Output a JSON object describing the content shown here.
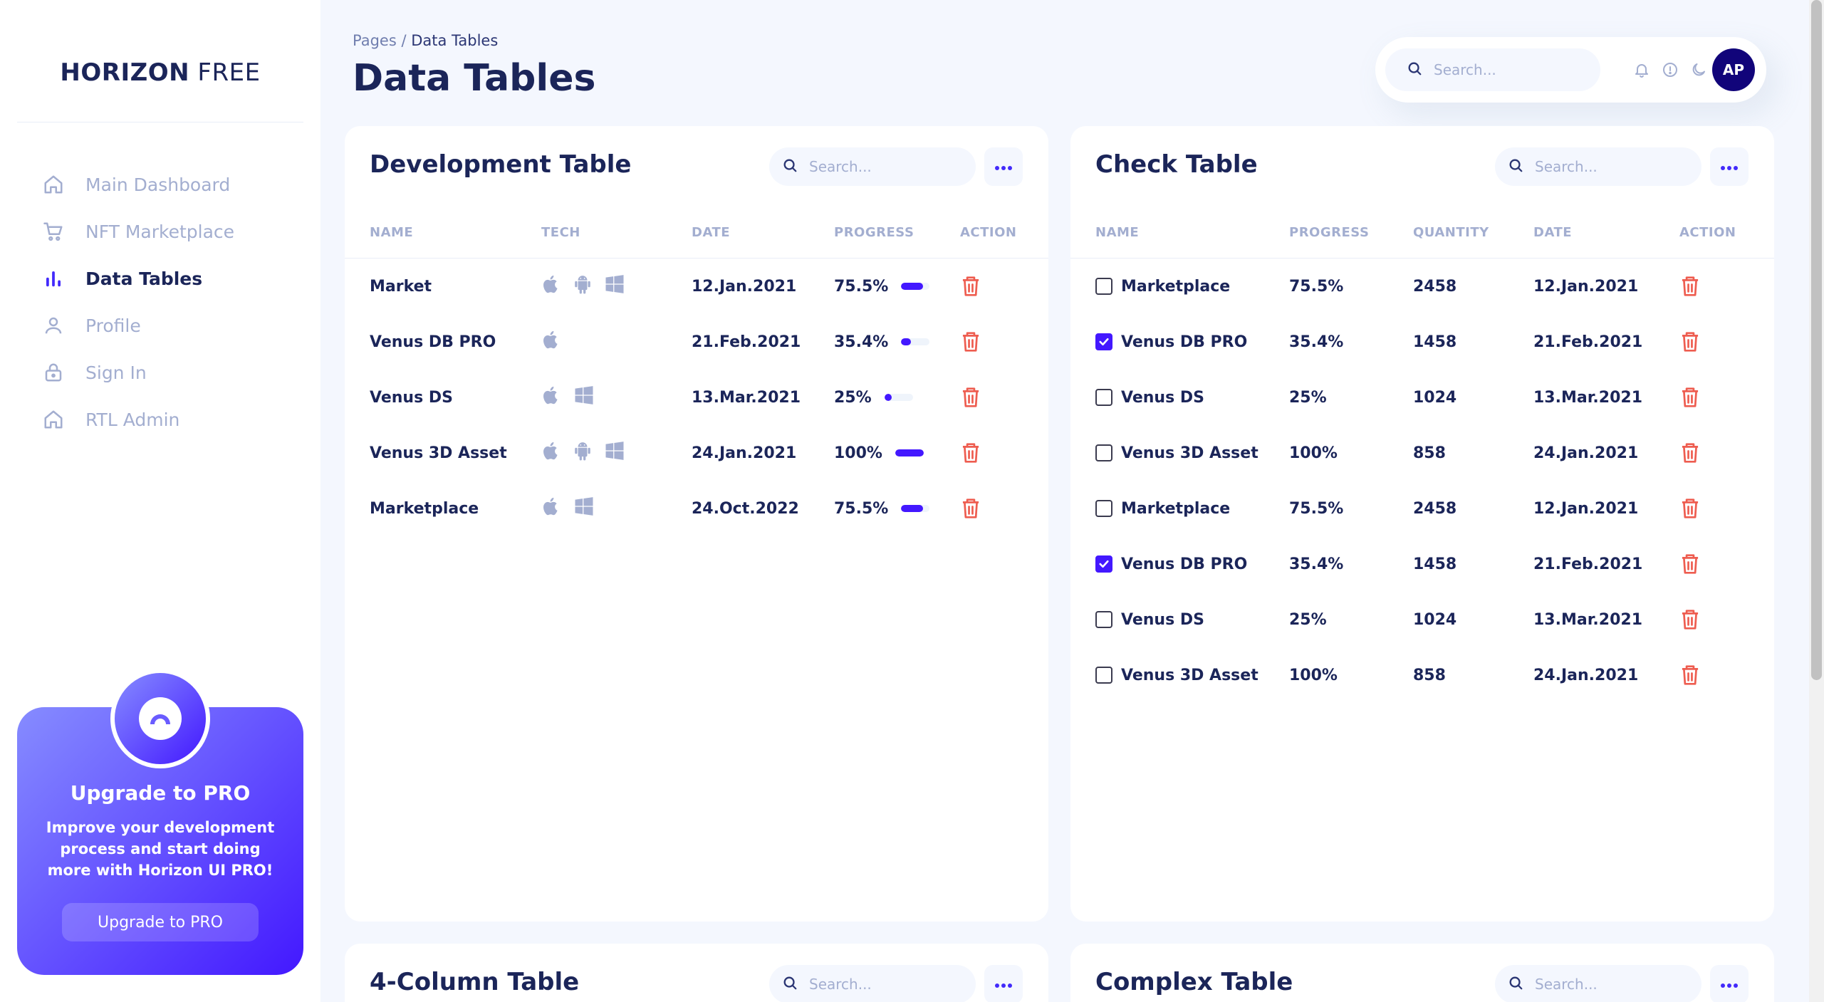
{
  "sidebar": {
    "brand_bold": "HORIZON",
    "brand_light": "FREE",
    "items": [
      {
        "label": "Main Dashboard",
        "icon": "home-icon"
      },
      {
        "label": "NFT Marketplace",
        "icon": "cart-icon"
      },
      {
        "label": "Data Tables",
        "icon": "bar-chart-icon",
        "active": true
      },
      {
        "label": "Profile",
        "icon": "user-icon"
      },
      {
        "label": "Sign In",
        "icon": "lock-icon"
      },
      {
        "label": "RTL Admin",
        "icon": "home-icon"
      }
    ],
    "upgrade": {
      "title": "Upgrade to PRO",
      "text": "Improve your development process and start doing more with Horizon UI PRO!",
      "button": "Upgrade to PRO"
    }
  },
  "header": {
    "breadcrumb_parent": "Pages",
    "breadcrumb_sep": " / ",
    "breadcrumb_current": "Data Tables",
    "title": "Data Tables",
    "search_placeholder": "Search...",
    "avatar_initials": "AP"
  },
  "colors": {
    "accent": "#4318ff",
    "navy": "#1b2559",
    "muted": "#a3aed0",
    "danger": "#ee5d50",
    "background": "#f4f7fe"
  },
  "development_table": {
    "title": "Development Table",
    "search_placeholder": "Search...",
    "columns": [
      "NAME",
      "TECH",
      "DATE",
      "PROGRESS",
      "ACTION"
    ],
    "rows": [
      {
        "name": "Market",
        "tech": [
          "apple",
          "android",
          "windows"
        ],
        "date": "12.Jan.2021",
        "progress": "75.5%",
        "progress_value": 0.755
      },
      {
        "name": "Venus DB PRO",
        "tech": [
          "apple"
        ],
        "date": "21.Feb.2021",
        "progress": "35.4%",
        "progress_value": 0.354
      },
      {
        "name": "Venus DS",
        "tech": [
          "apple",
          "windows"
        ],
        "date": "13.Mar.2021",
        "progress": "25%",
        "progress_value": 0.25
      },
      {
        "name": "Venus 3D Asset",
        "tech": [
          "apple",
          "android",
          "windows"
        ],
        "date": "24.Jan.2021",
        "progress": "100%",
        "progress_value": 1.0
      },
      {
        "name": "Marketplace",
        "tech": [
          "apple",
          "windows"
        ],
        "date": "24.Oct.2022",
        "progress": "75.5%",
        "progress_value": 0.755
      }
    ]
  },
  "check_table": {
    "title": "Check Table",
    "search_placeholder": "Search...",
    "columns": [
      "NAME",
      "PROGRESS",
      "QUANTITY",
      "DATE",
      "ACTION"
    ],
    "rows": [
      {
        "name": "Marketplace",
        "checked": false,
        "progress": "75.5%",
        "quantity": "2458",
        "date": "12.Jan.2021"
      },
      {
        "name": "Venus DB PRO",
        "checked": true,
        "progress": "35.4%",
        "quantity": "1458",
        "date": "21.Feb.2021"
      },
      {
        "name": "Venus DS",
        "checked": false,
        "progress": "25%",
        "quantity": "1024",
        "date": "13.Mar.2021"
      },
      {
        "name": "Venus 3D Asset",
        "checked": false,
        "progress": "100%",
        "quantity": "858",
        "date": "24.Jan.2021"
      },
      {
        "name": "Marketplace",
        "checked": false,
        "progress": "75.5%",
        "quantity": "2458",
        "date": "12.Jan.2021"
      },
      {
        "name": "Venus DB PRO",
        "checked": true,
        "progress": "35.4%",
        "quantity": "1458",
        "date": "21.Feb.2021"
      },
      {
        "name": "Venus DS",
        "checked": false,
        "progress": "25%",
        "quantity": "1024",
        "date": "13.Mar.2021"
      },
      {
        "name": "Venus 3D Asset",
        "checked": false,
        "progress": "100%",
        "quantity": "858",
        "date": "24.Jan.2021"
      }
    ]
  },
  "four_column_table": {
    "title": "4-Column Table",
    "search_placeholder": "Search..."
  },
  "complex_table": {
    "title": "Complex Table",
    "search_placeholder": "Search..."
  }
}
